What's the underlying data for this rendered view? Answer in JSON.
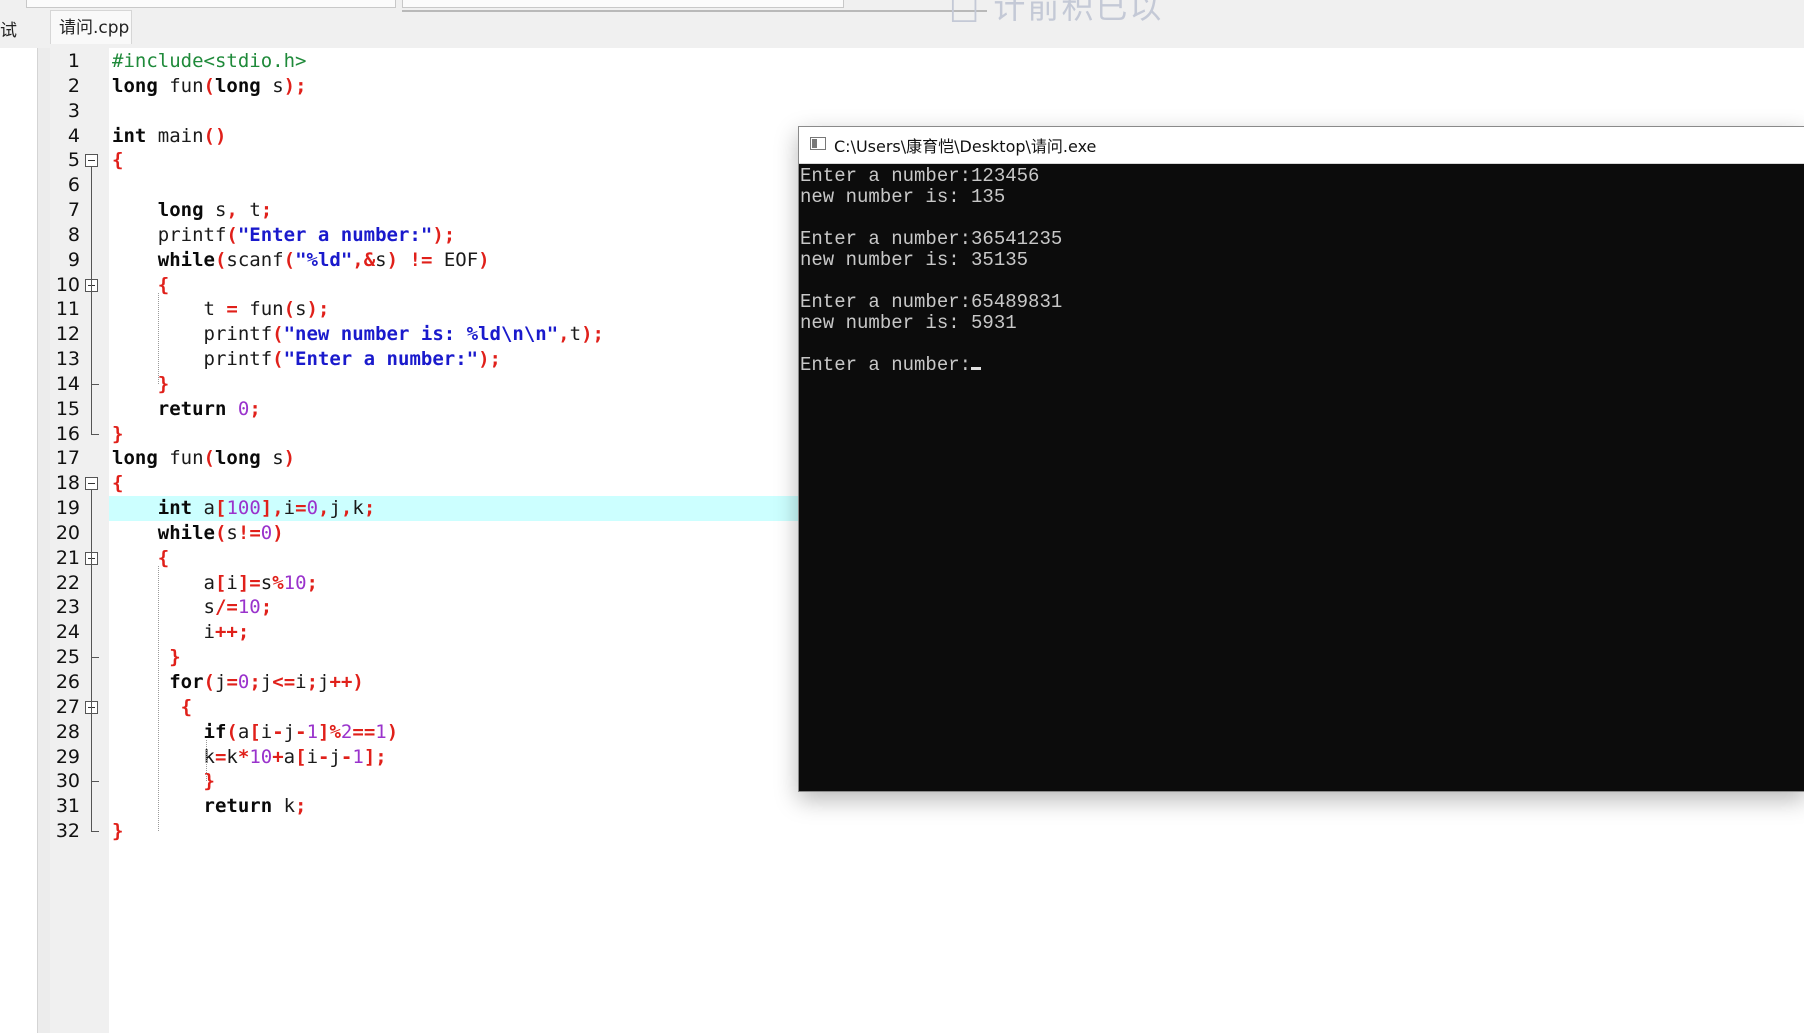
{
  "top": {
    "left_tab_label": "试",
    "file_tab_label": "请问.cpp"
  },
  "code": [
    {
      "n": "1",
      "tokens": [
        {
          "t": "#include<stdio.h>",
          "c": "pre"
        }
      ]
    },
    {
      "n": "2",
      "tokens": [
        {
          "t": "long",
          "c": "kw"
        },
        {
          "t": " fun",
          "c": "plain"
        },
        {
          "t": "(",
          "c": "op"
        },
        {
          "t": "long",
          "c": "kw"
        },
        {
          "t": " s",
          "c": "plain"
        },
        {
          "t": ");",
          "c": "op"
        }
      ]
    },
    {
      "n": "3",
      "tokens": []
    },
    {
      "n": "4",
      "tokens": [
        {
          "t": "int",
          "c": "kw"
        },
        {
          "t": " main",
          "c": "plain"
        },
        {
          "t": "()",
          "c": "op"
        }
      ]
    },
    {
      "n": "5",
      "tokens": [
        {
          "t": "{",
          "c": "op"
        }
      ]
    },
    {
      "n": "6",
      "tokens": []
    },
    {
      "n": "7",
      "tokens": [
        {
          "t": "    ",
          "c": "plain"
        },
        {
          "t": "long",
          "c": "kw"
        },
        {
          "t": " s",
          "c": "plain"
        },
        {
          "t": ",",
          "c": "op"
        },
        {
          "t": " t",
          "c": "plain"
        },
        {
          "t": ";",
          "c": "op"
        }
      ]
    },
    {
      "n": "8",
      "tokens": [
        {
          "t": "    printf",
          "c": "plain"
        },
        {
          "t": "(",
          "c": "op"
        },
        {
          "t": "\"Enter a number:\"",
          "c": "str"
        },
        {
          "t": ");",
          "c": "op"
        }
      ]
    },
    {
      "n": "9",
      "tokens": [
        {
          "t": "    ",
          "c": "plain"
        },
        {
          "t": "while",
          "c": "kw"
        },
        {
          "t": "(",
          "c": "op"
        },
        {
          "t": "scanf",
          "c": "plain"
        },
        {
          "t": "(",
          "c": "op"
        },
        {
          "t": "\"%ld\"",
          "c": "str"
        },
        {
          "t": ",&",
          "c": "op"
        },
        {
          "t": "s",
          "c": "plain"
        },
        {
          "t": ") != ",
          "c": "op"
        },
        {
          "t": "EOF",
          "c": "plain"
        },
        {
          "t": ")",
          "c": "op"
        }
      ]
    },
    {
      "n": "10",
      "tokens": [
        {
          "t": "    ",
          "c": "plain"
        },
        {
          "t": "{",
          "c": "op"
        }
      ]
    },
    {
      "n": "11",
      "tokens": [
        {
          "t": "        t ",
          "c": "plain"
        },
        {
          "t": "=",
          "c": "op"
        },
        {
          "t": " fun",
          "c": "plain"
        },
        {
          "t": "(",
          "c": "op"
        },
        {
          "t": "s",
          "c": "plain"
        },
        {
          "t": ");",
          "c": "op"
        }
      ]
    },
    {
      "n": "12",
      "tokens": [
        {
          "t": "        printf",
          "c": "plain"
        },
        {
          "t": "(",
          "c": "op"
        },
        {
          "t": "\"new number is: %ld\\n\\n\"",
          "c": "str"
        },
        {
          "t": ",",
          "c": "op"
        },
        {
          "t": "t",
          "c": "plain"
        },
        {
          "t": ");",
          "c": "op"
        }
      ]
    },
    {
      "n": "13",
      "tokens": [
        {
          "t": "        printf",
          "c": "plain"
        },
        {
          "t": "(",
          "c": "op"
        },
        {
          "t": "\"Enter a number:\"",
          "c": "str"
        },
        {
          "t": ");",
          "c": "op"
        }
      ]
    },
    {
      "n": "14",
      "tokens": [
        {
          "t": "    ",
          "c": "plain"
        },
        {
          "t": "}",
          "c": "op"
        }
      ]
    },
    {
      "n": "15",
      "tokens": [
        {
          "t": "    ",
          "c": "plain"
        },
        {
          "t": "return",
          "c": "kw"
        },
        {
          "t": " ",
          "c": "plain"
        },
        {
          "t": "0",
          "c": "num"
        },
        {
          "t": ";",
          "c": "op"
        }
      ]
    },
    {
      "n": "16",
      "tokens": [
        {
          "t": "}",
          "c": "op"
        }
      ]
    },
    {
      "n": "17",
      "tokens": [
        {
          "t": "long",
          "c": "kw"
        },
        {
          "t": " fun",
          "c": "plain"
        },
        {
          "t": "(",
          "c": "op"
        },
        {
          "t": "long",
          "c": "kw"
        },
        {
          "t": " s",
          "c": "plain"
        },
        {
          "t": ")",
          "c": "op"
        }
      ]
    },
    {
      "n": "18",
      "tokens": [
        {
          "t": "{",
          "c": "op"
        }
      ]
    },
    {
      "n": "19",
      "tokens": [
        {
          "t": "    ",
          "c": "plain"
        },
        {
          "t": "int",
          "c": "kw"
        },
        {
          "t": " a",
          "c": "plain"
        },
        {
          "t": "[",
          "c": "op"
        },
        {
          "t": "100",
          "c": "num"
        },
        {
          "t": "],",
          "c": "op"
        },
        {
          "t": "i",
          "c": "plain"
        },
        {
          "t": "=",
          "c": "op"
        },
        {
          "t": "0",
          "c": "num"
        },
        {
          "t": ",",
          "c": "op"
        },
        {
          "t": "j",
          "c": "plain"
        },
        {
          "t": ",",
          "c": "op"
        },
        {
          "t": "k",
          "c": "plain"
        },
        {
          "t": ";",
          "c": "op"
        }
      ]
    },
    {
      "n": "20",
      "tokens": [
        {
          "t": "    ",
          "c": "plain"
        },
        {
          "t": "while",
          "c": "kw"
        },
        {
          "t": "(",
          "c": "op"
        },
        {
          "t": "s",
          "c": "plain"
        },
        {
          "t": "!=",
          "c": "op"
        },
        {
          "t": "0",
          "c": "num"
        },
        {
          "t": ")",
          "c": "op"
        }
      ]
    },
    {
      "n": "21",
      "tokens": [
        {
          "t": "    ",
          "c": "plain"
        },
        {
          "t": "{",
          "c": "op"
        }
      ]
    },
    {
      "n": "22",
      "tokens": [
        {
          "t": "        a",
          "c": "plain"
        },
        {
          "t": "[",
          "c": "op"
        },
        {
          "t": "i",
          "c": "plain"
        },
        {
          "t": "]=",
          "c": "op"
        },
        {
          "t": "s",
          "c": "plain"
        },
        {
          "t": "%",
          "c": "op"
        },
        {
          "t": "10",
          "c": "num"
        },
        {
          "t": ";",
          "c": "op"
        }
      ]
    },
    {
      "n": "23",
      "tokens": [
        {
          "t": "        s",
          "c": "plain"
        },
        {
          "t": "/=",
          "c": "op"
        },
        {
          "t": "10",
          "c": "num"
        },
        {
          "t": ";",
          "c": "op"
        }
      ]
    },
    {
      "n": "24",
      "tokens": [
        {
          "t": "        i",
          "c": "plain"
        },
        {
          "t": "++;",
          "c": "op"
        }
      ]
    },
    {
      "n": "25",
      "tokens": [
        {
          "t": "     ",
          "c": "plain"
        },
        {
          "t": "}",
          "c": "op"
        }
      ]
    },
    {
      "n": "26",
      "tokens": [
        {
          "t": "     ",
          "c": "plain"
        },
        {
          "t": "for",
          "c": "kw"
        },
        {
          "t": "(",
          "c": "op"
        },
        {
          "t": "j",
          "c": "plain"
        },
        {
          "t": "=",
          "c": "op"
        },
        {
          "t": "0",
          "c": "num"
        },
        {
          "t": ";",
          "c": "op"
        },
        {
          "t": "j",
          "c": "plain"
        },
        {
          "t": "<=",
          "c": "op"
        },
        {
          "t": "i",
          "c": "plain"
        },
        {
          "t": ";",
          "c": "op"
        },
        {
          "t": "j",
          "c": "plain"
        },
        {
          "t": "++)",
          "c": "op"
        }
      ]
    },
    {
      "n": "27",
      "tokens": [
        {
          "t": "      ",
          "c": "plain"
        },
        {
          "t": "{",
          "c": "op"
        }
      ]
    },
    {
      "n": "28",
      "tokens": [
        {
          "t": "        ",
          "c": "plain"
        },
        {
          "t": "if",
          "c": "kw"
        },
        {
          "t": "(",
          "c": "op"
        },
        {
          "t": "a",
          "c": "plain"
        },
        {
          "t": "[",
          "c": "op"
        },
        {
          "t": "i",
          "c": "plain"
        },
        {
          "t": "-",
          "c": "op"
        },
        {
          "t": "j",
          "c": "plain"
        },
        {
          "t": "-",
          "c": "op"
        },
        {
          "t": "1",
          "c": "num"
        },
        {
          "t": "]%",
          "c": "op"
        },
        {
          "t": "2",
          "c": "num"
        },
        {
          "t": "==",
          "c": "op"
        },
        {
          "t": "1",
          "c": "num"
        },
        {
          "t": ")",
          "c": "op"
        }
      ]
    },
    {
      "n": "29",
      "tokens": [
        {
          "t": "        k",
          "c": "plain"
        },
        {
          "t": "=",
          "c": "op"
        },
        {
          "t": "k",
          "c": "plain"
        },
        {
          "t": "*",
          "c": "op"
        },
        {
          "t": "10",
          "c": "num"
        },
        {
          "t": "+",
          "c": "op"
        },
        {
          "t": "a",
          "c": "plain"
        },
        {
          "t": "[",
          "c": "op"
        },
        {
          "t": "i",
          "c": "plain"
        },
        {
          "t": "-",
          "c": "op"
        },
        {
          "t": "j",
          "c": "plain"
        },
        {
          "t": "-",
          "c": "op"
        },
        {
          "t": "1",
          "c": "num"
        },
        {
          "t": "];",
          "c": "op"
        }
      ]
    },
    {
      "n": "30",
      "tokens": [
        {
          "t": "        ",
          "c": "plain"
        },
        {
          "t": "}",
          "c": "op"
        }
      ]
    },
    {
      "n": "31",
      "tokens": [
        {
          "t": "        ",
          "c": "plain"
        },
        {
          "t": "return",
          "c": "kw"
        },
        {
          "t": " k",
          "c": "plain"
        },
        {
          "t": ";",
          "c": "op"
        }
      ]
    },
    {
      "n": "32",
      "tokens": [
        {
          "t": "}",
          "c": "op"
        }
      ]
    }
  ],
  "active_line": "19",
  "colors": {
    "keyword": "#0a0a0a",
    "string": "#1a1acc",
    "number": "#9a33cc",
    "operator": "#e0201a",
    "preprocessor": "#1f8a3a",
    "active_line": "#ccffff",
    "console_bg": "#0c0c0c",
    "console_text": "#c8c8c8"
  },
  "console": {
    "title": "C:\\Users\\康育恺\\Desktop\\请问.exe",
    "icon": "console-window-icon",
    "lines": [
      "Enter a number:123456",
      "new number is: 135",
      "",
      "Enter a number:36541235",
      "new number is: 35135",
      "",
      "Enter a number:65489831",
      "new number is: 5931",
      "",
      "Enter a number:"
    ]
  }
}
